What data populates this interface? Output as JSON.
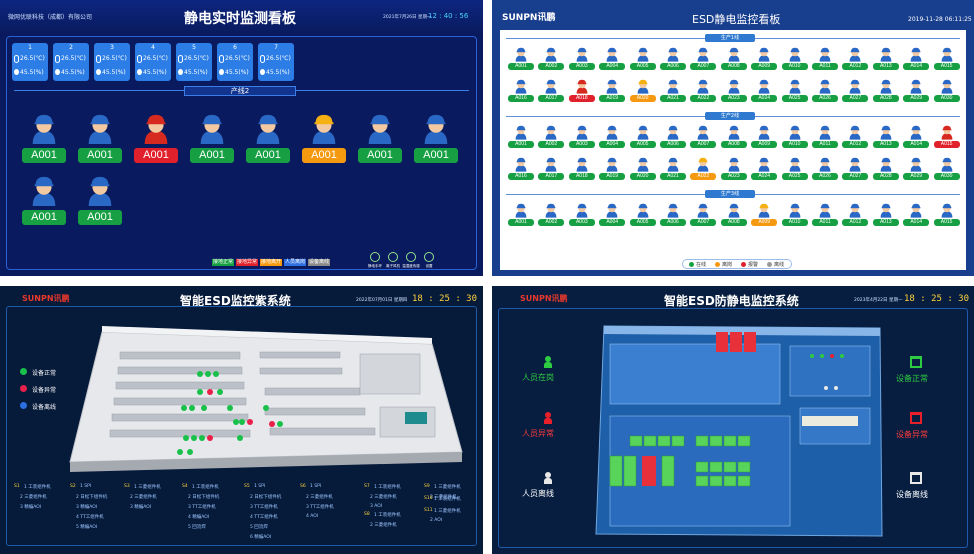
{
  "panel1": {
    "company": "微网优联科技（成都）有限公司",
    "title": "静电实时监测看板",
    "date": "2021年7月26日 星期一",
    "time": "12 : 40 : 56",
    "line_label": "产线2",
    "sensors": [
      {
        "id": "1",
        "temp": "26.5(℃)",
        "hum": "45.5(%)"
      },
      {
        "id": "2",
        "temp": "26.5(℃)",
        "hum": "45.5(%)"
      },
      {
        "id": "3",
        "temp": "26.5(℃)",
        "hum": "45.5(%)"
      },
      {
        "id": "4",
        "temp": "26.5(℃)",
        "hum": "45.5(%)"
      },
      {
        "id": "5",
        "temp": "26.5(℃)",
        "hum": "45.5(%)"
      },
      {
        "id": "6",
        "temp": "26.5(℃)",
        "hum": "45.5(%)"
      },
      {
        "id": "7",
        "temp": "26.5(℃)",
        "hum": "45.5(%)"
      }
    ],
    "workers": [
      {
        "label": "A001",
        "status": "normal"
      },
      {
        "label": "A001",
        "status": "normal"
      },
      {
        "label": "A001",
        "status": "alarm"
      },
      {
        "label": "A001",
        "status": "normal"
      },
      {
        "label": "A001",
        "status": "normal"
      },
      {
        "label": "A001",
        "status": "away"
      },
      {
        "label": "A001",
        "status": "normal"
      },
      {
        "label": "A001",
        "status": "normal"
      },
      {
        "label": "A001",
        "status": "normal"
      },
      {
        "label": "A001",
        "status": "normal"
      }
    ],
    "legend": [
      "接地正常",
      "接地异常",
      "接地离开",
      "人员离岗",
      "设备离线"
    ],
    "footer_icons": [
      "静电手环",
      "离子风机",
      "温湿度传感",
      "设置"
    ],
    "colors": {
      "normal": "#17a043",
      "alarm": "#e0202a",
      "away": "#f59a10",
      "offline": "#8a8a8a",
      "left": "#2f6fe0"
    }
  },
  "panel2": {
    "brand": "SUNPN讯鹏",
    "title": "ESD静电监控看板",
    "datetime": "2019-11-28 06:11:25",
    "lines": [
      {
        "name": "生产1线",
        "rows": [
          [
            "A001",
            "A002",
            "A003",
            "A004",
            "A005",
            "A006",
            "A007",
            "A008",
            "A009",
            "A010",
            "A011",
            "A012",
            "A013",
            "A014",
            "A015"
          ],
          [
            "A016",
            "A017",
            "A018",
            "A019",
            "A020",
            "A021",
            "A022",
            "A023",
            "A024",
            "A025",
            "A026",
            "A027",
            "A028",
            "A029",
            "A030"
          ]
        ],
        "alarm": [
          "A018"
        ],
        "away": [
          "A020"
        ]
      },
      {
        "name": "生产2线",
        "rows": [
          [
            "A001",
            "A002",
            "A003",
            "A004",
            "A005",
            "A006",
            "A007",
            "A008",
            "A009",
            "A010",
            "A011",
            "A012",
            "A013",
            "A014",
            "A015"
          ],
          [
            "A016",
            "A017",
            "A018",
            "A019",
            "A020",
            "A021",
            "A022",
            "A023",
            "A024",
            "A025",
            "A026",
            "A027",
            "A028",
            "A029",
            "A030"
          ]
        ],
        "alarm": [
          "A015"
        ],
        "away": [
          "A022"
        ]
      },
      {
        "name": "生产3线",
        "rows": [
          [
            "A001",
            "A002",
            "A003",
            "A004",
            "A005",
            "A006",
            "A007",
            "A008",
            "A009",
            "A010",
            "A011",
            "A012",
            "A013",
            "A014",
            "A015"
          ]
        ],
        "alarm": [],
        "away": [
          "A009"
        ]
      }
    ],
    "legend": [
      "在线",
      "离岗",
      "报警",
      "离线"
    ]
  },
  "panel3": {
    "brand": "SUNPN讯鹏",
    "title": "智能ESD监控紫系统",
    "date": "2022年07月01日 星期四",
    "time": "18 : 25 : 30",
    "legend": [
      "设备正常",
      "设备异常",
      "设备离线"
    ],
    "lines": [
      {
        "name": "S1",
        "items": [
          "1 工装组件机",
          "2 三菱组件机",
          "3 精编AOI"
        ]
      },
      {
        "name": "S2",
        "items": [
          "1 SPI",
          "2 日松下组件机",
          "3 精编AOI",
          "4 TT工组件机",
          "5 精编AOI"
        ]
      },
      {
        "name": "S3",
        "items": [
          "1 三菱组件机",
          "2 三菱组件机",
          "3 精编AOI"
        ]
      },
      {
        "name": "S4",
        "items": [
          "1 工装组件机",
          "2 日松下组件机",
          "3 TT工组件机",
          "4 精编AOI",
          "5 回流焊"
        ]
      },
      {
        "name": "S5",
        "items": [
          "1 SPI",
          "2 日松下组件机",
          "3 TT工组件机",
          "4 TT工组件机",
          "5 回流焊",
          "6 精编AOI"
        ]
      },
      {
        "name": "S6",
        "items": [
          "1 SPI",
          "2 三菱组件机",
          "3 TT工组件机",
          "4 AOI"
        ]
      },
      {
        "name": "S7",
        "items": [
          "1 工装组件机",
          "2 三菱组件机",
          "3 AOI"
        ]
      },
      {
        "name": "S8",
        "items": [
          "1 工装组件机",
          "2 三菱组件机",
          "3 AOI"
        ]
      },
      {
        "name": "S9",
        "items": [
          "1 三菱组件机",
          "2 三菱组件机",
          "3 AOI"
        ]
      },
      {
        "name": "S10",
        "items": [
          "1 工装组件机"
        ]
      },
      {
        "name": "S11",
        "items": [
          "1 三菱组件机",
          "2 AOI"
        ]
      }
    ]
  },
  "panel4": {
    "brand": "SUNPN讯鹏",
    "title": "智能ESD防静电监控系统",
    "date": "2023年4月22日 星期一",
    "time": "18 : 25 : 30",
    "left_legend": [
      "人员在岗",
      "人员异常",
      "人员离线"
    ],
    "right_legend": [
      "设备正常",
      "设备异常",
      "设备离线"
    ]
  }
}
